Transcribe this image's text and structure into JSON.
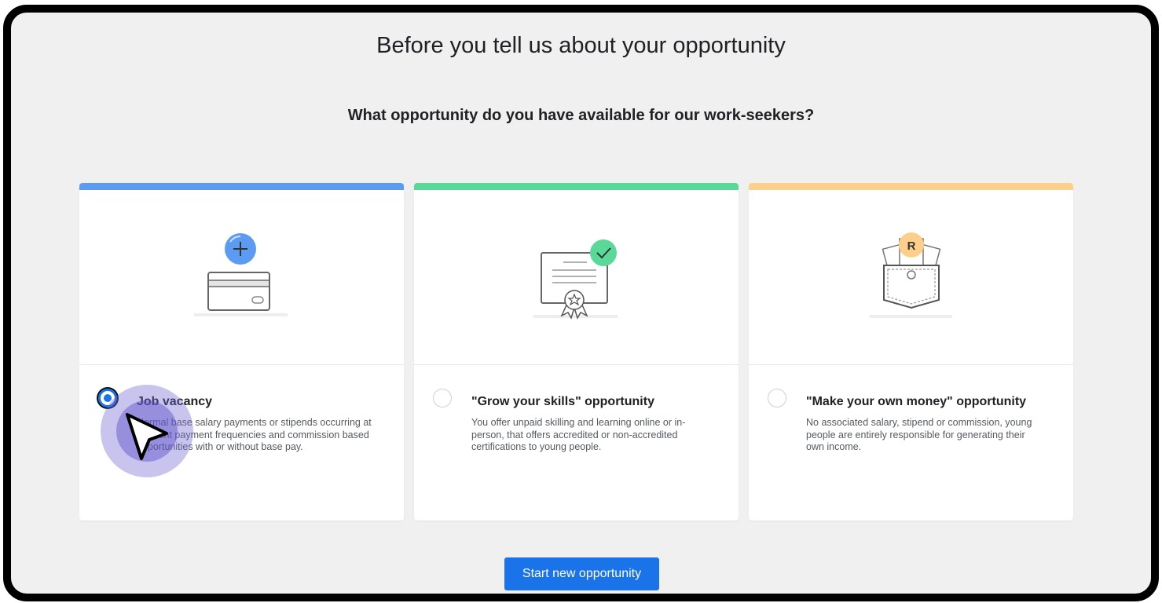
{
  "page": {
    "title": "Before you tell us about your opportunity",
    "question": "What opportunity do you have available for our work-seekers?"
  },
  "options": [
    {
      "title": "Job vacancy",
      "description": "Normal base salary payments or stipends occurring at different payment frequencies and commission based opportunities with or without base pay.",
      "accent_color": "#5b9bf2",
      "icon": "credit-card-plus-icon",
      "selected": true
    },
    {
      "title": "\"Grow your skills\" opportunity",
      "description": "You offer unpaid skilling and learning online or in-person, that offers accredited or non-accredited certifications to young people.",
      "accent_color": "#5ad897",
      "icon": "certificate-icon",
      "selected": false
    },
    {
      "title": "\"Make your own money\" opportunity",
      "description": "No associated salary, stipend or commission, young people are entirely responsible for generating their own income.",
      "accent_color": "#fdcf8a",
      "icon": "money-pocket-icon",
      "icon_label": "R",
      "selected": false
    }
  ],
  "actions": {
    "start_label": "Start new opportunity"
  },
  "colors": {
    "primary": "#1a73e8",
    "background": "#f0f0f0"
  }
}
